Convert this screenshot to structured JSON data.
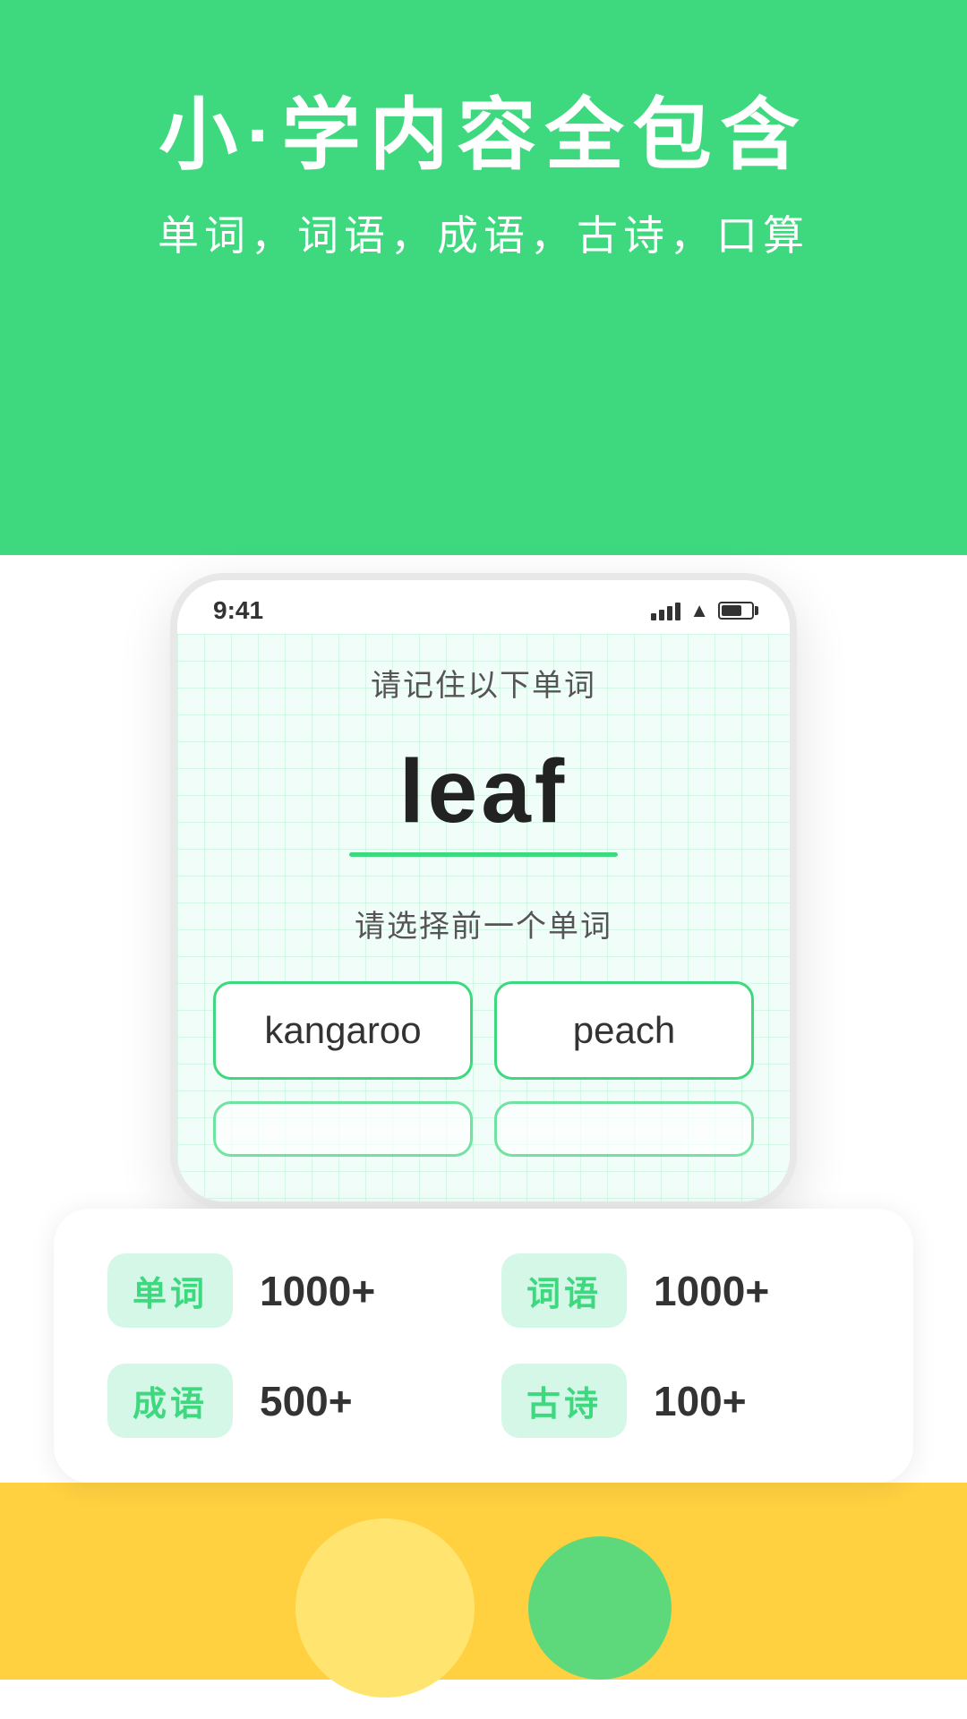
{
  "header": {
    "main_title": "小·学内容全包含",
    "subtitle": "单词，词语，成语，古诗，口算"
  },
  "phone": {
    "status_bar": {
      "time": "9:41"
    },
    "instruction1": "请记住以下单词",
    "main_word": "leaf",
    "instruction2": "请选择前一个单词",
    "options": [
      {
        "label": "kangaroo"
      },
      {
        "label": "peach"
      }
    ]
  },
  "stats": {
    "items": [
      {
        "badge": "单词",
        "count": "1000+"
      },
      {
        "badge": "词语",
        "count": "1000+"
      },
      {
        "badge": "成语",
        "count": "500+"
      },
      {
        "badge": "古诗",
        "count": "100+"
      }
    ]
  },
  "colors": {
    "green": "#3ED87E",
    "green_light": "#d4f7e8",
    "yellow": "#FFD040"
  }
}
